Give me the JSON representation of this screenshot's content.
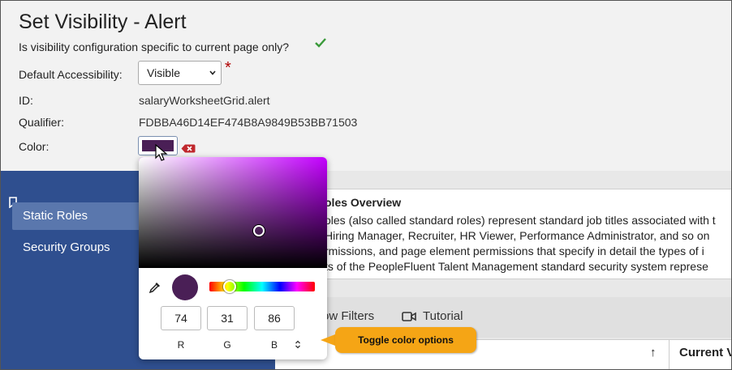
{
  "header": {
    "title": "Set Visibility - Alert",
    "question": "Is visibility configuration specific to current page only?"
  },
  "form": {
    "accessibility_label": "Default Accessibility:",
    "accessibility_value": "Visible",
    "required_marker": "*",
    "id_label": "ID:",
    "id_value": "salaryWorksheetGrid.alert",
    "qualifier_label": "Qualifier:",
    "qualifier_value": "FDBBA46D14EF474B8A9849B53BB71503",
    "color_label": "Color:"
  },
  "colors": {
    "selected": "#4a1f56",
    "hue": "#c400ff",
    "sidebar": "#2f4f8f",
    "callout": "#f5a515",
    "check": "#3a9a3a",
    "required": "#b00000"
  },
  "color_picker": {
    "r": "74",
    "g": "31",
    "b": "86",
    "r_label": "R",
    "g_label": "G",
    "b_label": "B"
  },
  "callout": {
    "text": "Toggle color options"
  },
  "sidebar": {
    "items": [
      {
        "label": "Static Roles",
        "active": true
      },
      {
        "label": "Security Groups",
        "active": false
      }
    ]
  },
  "overview": {
    "title": "oles Overview",
    "lines": [
      "oles (also called standard roles) represent standard job titles associated with t",
      "Hiring Manager, Recruiter, HR Viewer, Performance Administrator, and so on",
      "rmissions, and page element permissions that specify in detail the types of i",
      "ts of the PeopleFluent Talent Management standard security system represe"
    ]
  },
  "toolbar": {
    "filters_label": "ow Filters",
    "tutorial_label": "Tutorial"
  },
  "table": {
    "sort_symbol": "↑",
    "column_label": "Current V"
  },
  "icons": {
    "check": "check-icon",
    "clear": "clear-color-icon",
    "cursor": "mouse-cursor-icon",
    "dropper": "eyedropper-icon",
    "toggle": "toggle-chevron-icon",
    "video": "video-camera-icon",
    "bookmark": "bookmark-icon"
  }
}
